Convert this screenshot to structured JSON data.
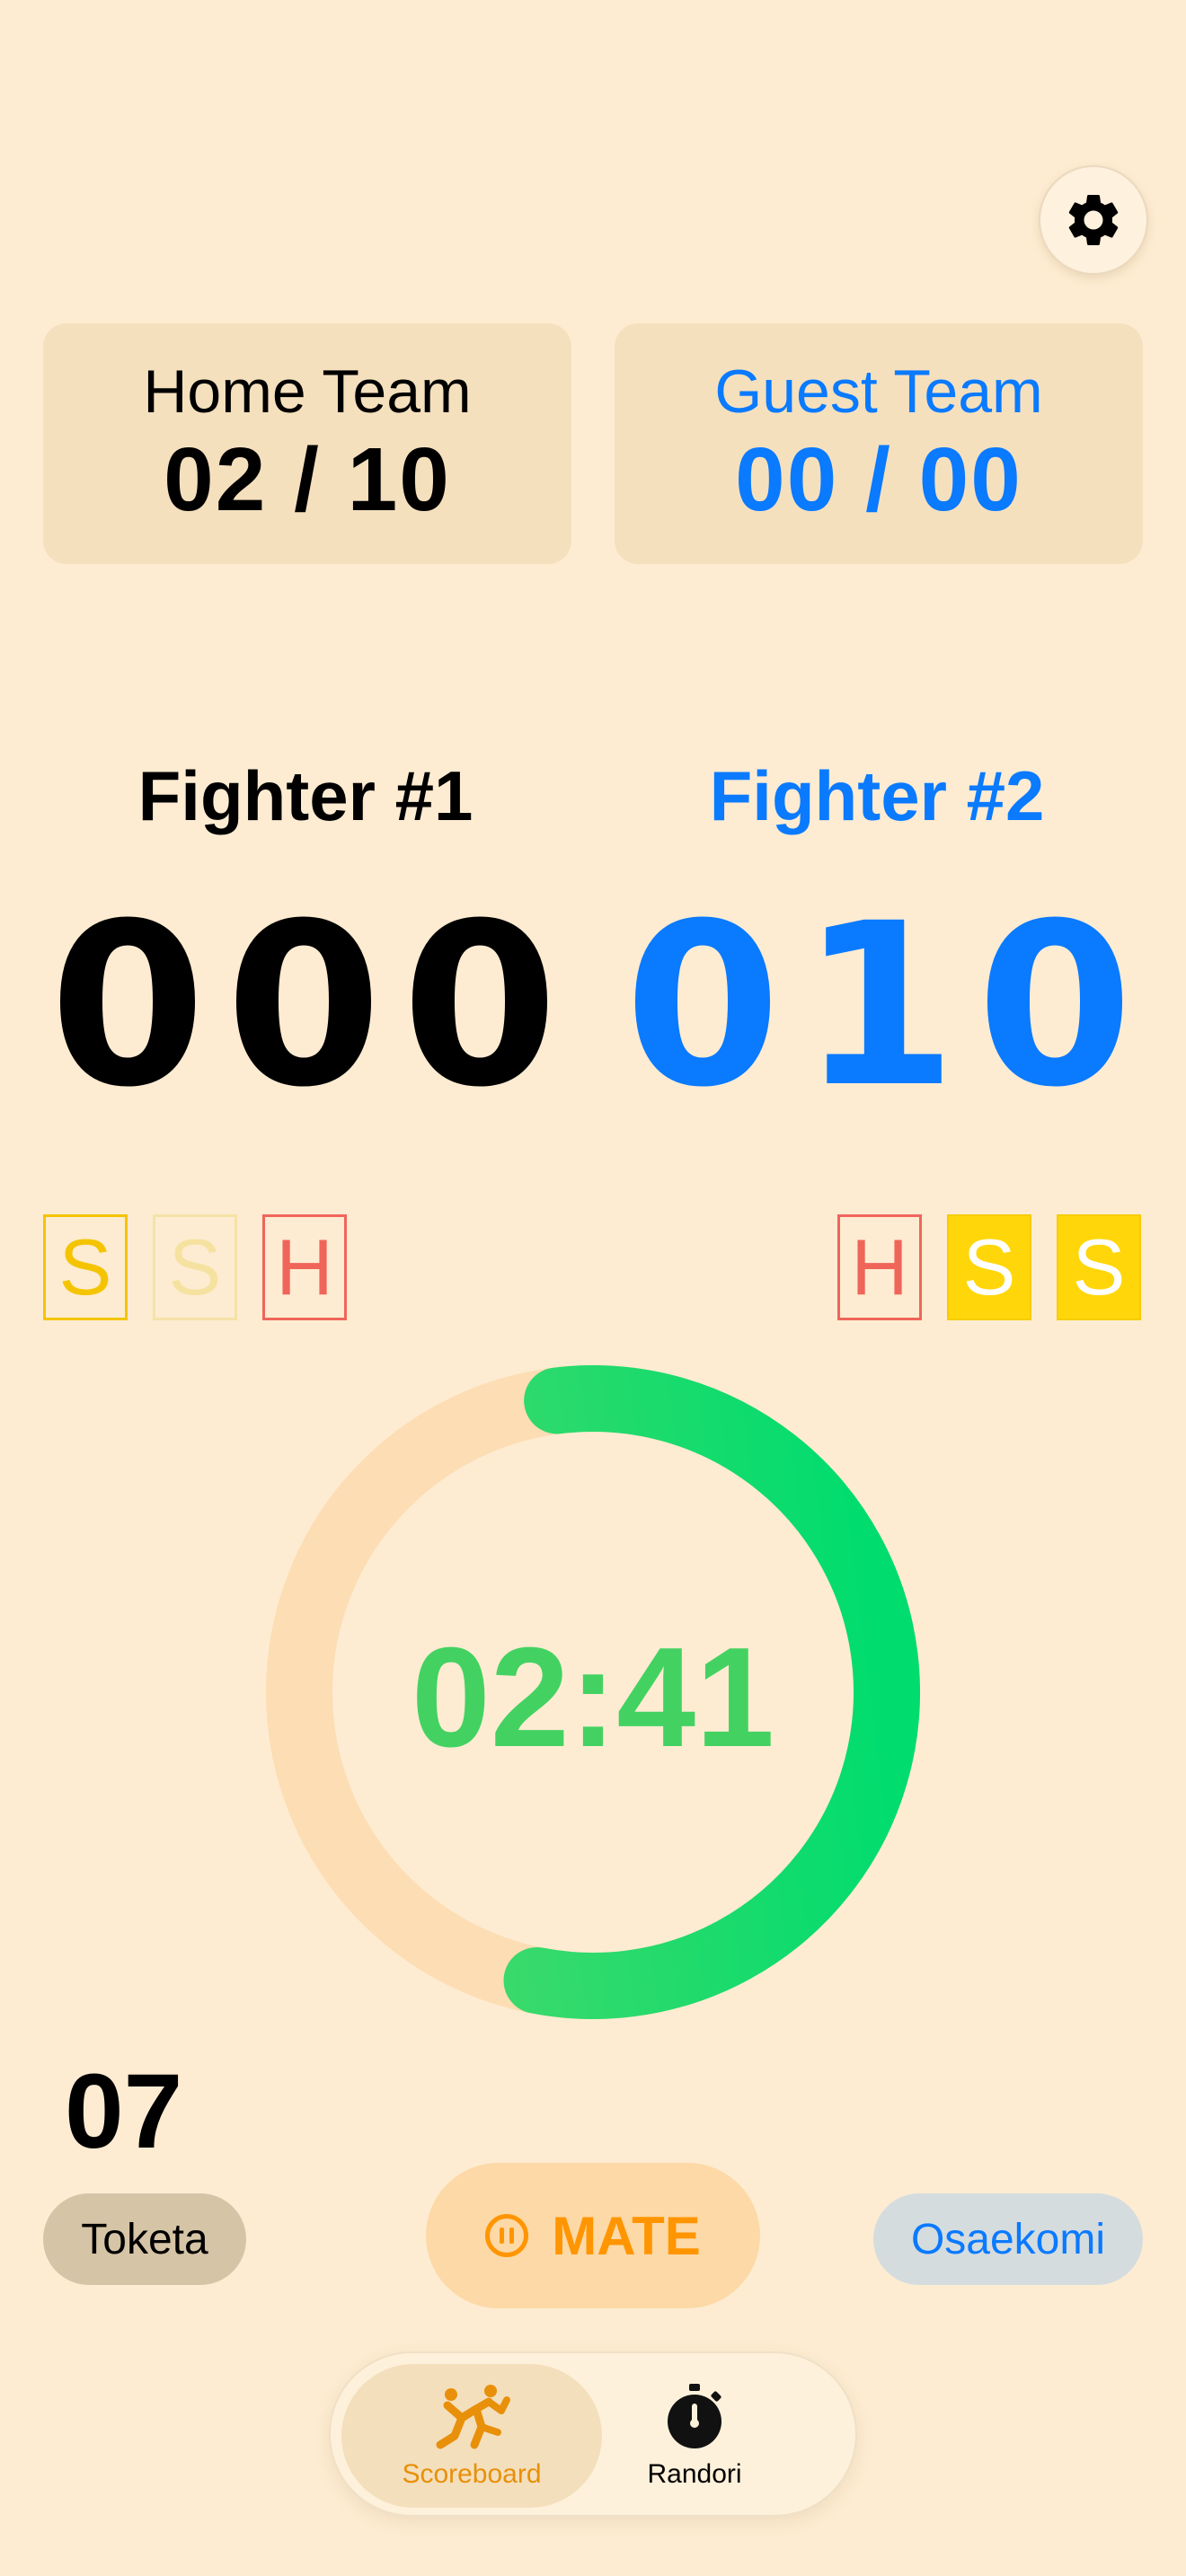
{
  "teams": {
    "home": {
      "name": "Home Team",
      "score": "02 / 10"
    },
    "guest": {
      "name": "Guest Team",
      "score": "00 / 00"
    }
  },
  "fighters": {
    "one": {
      "name": "Fighter #1",
      "digits": [
        "0",
        "0",
        "0"
      ],
      "penalties": [
        "S",
        "S",
        "H"
      ]
    },
    "two": {
      "name": "Fighter #2",
      "digits": [
        "0",
        "1",
        "0"
      ],
      "penalties": [
        "H",
        "S",
        "S"
      ]
    }
  },
  "timer": {
    "display": "02:41",
    "progress": 0.55
  },
  "counter": "07",
  "buttons": {
    "toketa": "Toketa",
    "mate": "MATE",
    "osaekomi": "Osaekomi"
  },
  "tabs": [
    {
      "label": "Scoreboard",
      "icon": "judo-throw-icon",
      "active": true
    },
    {
      "label": "Randori",
      "icon": "stopwatch-icon",
      "active": false
    }
  ],
  "colors": {
    "background": "#FDECD2",
    "accent_blue": "#0A7AFF",
    "accent_orange": "#FF9500",
    "timer_green": "#43D262",
    "shido_yellow": "#FFD60A",
    "hansoku_red": "#F0655A"
  },
  "icons": {
    "settings": "gear-icon",
    "mate": "pause-icon"
  }
}
